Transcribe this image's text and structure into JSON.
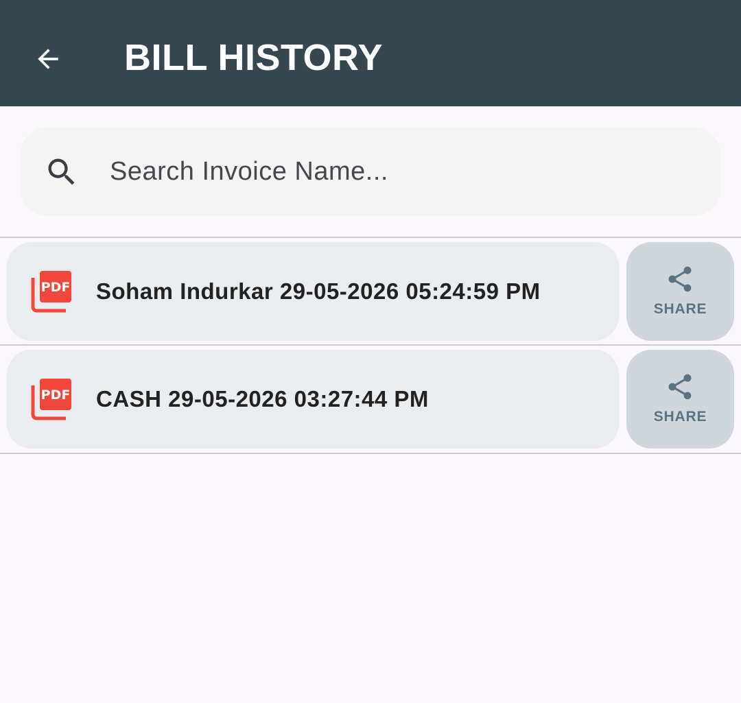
{
  "header": {
    "title": "BILL HISTORY",
    "back_icon": "arrow-back-icon",
    "background": "#37474f"
  },
  "search": {
    "placeholder": "Search Invoice Name...",
    "value": "",
    "icon": "search-icon"
  },
  "bills": [
    {
      "label": "Soham Indurkar 29-05-2026 05:24:59 PM",
      "icon": "pdf-icon",
      "share_label": "SHARE"
    },
    {
      "label": "CASH 29-05-2026 03:27:44 PM",
      "icon": "pdf-icon",
      "share_label": "SHARE"
    }
  ],
  "colors": {
    "pdf_red": "#f0463c",
    "share_icon": "#5b7380",
    "card_bg": "#e9edf0",
    "share_bg": "#d0d7dc"
  }
}
